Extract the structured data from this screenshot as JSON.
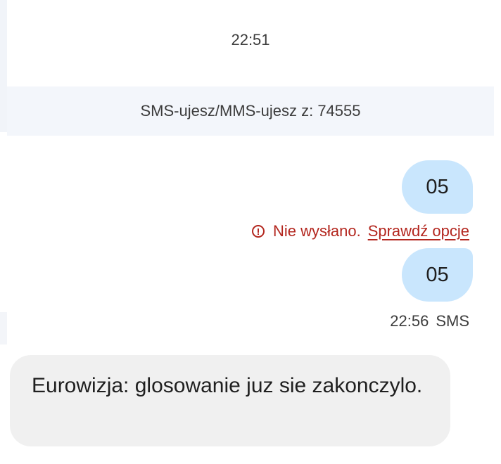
{
  "conversation": {
    "top_timestamp": "22:51",
    "sender_banner": "SMS-ujesz/MMS-ujesz z: 74555"
  },
  "messages": {
    "outgoing_1": {
      "text": "05",
      "status_text": "Nie wysłano.",
      "status_link": "Sprawdź opcje",
      "status_icon": "error-circle-icon"
    },
    "outgoing_2": {
      "text": "05",
      "time": "22:56",
      "type": "SMS"
    },
    "incoming_1": {
      "text": "Eurowizja: glosowanie juz sie zakonczylo."
    }
  },
  "colors": {
    "outgoing_bubble": "#c9e6fd",
    "incoming_bubble": "#f0f0f0",
    "error": "#b3261e",
    "banner_bg": "#f3f6fb"
  }
}
